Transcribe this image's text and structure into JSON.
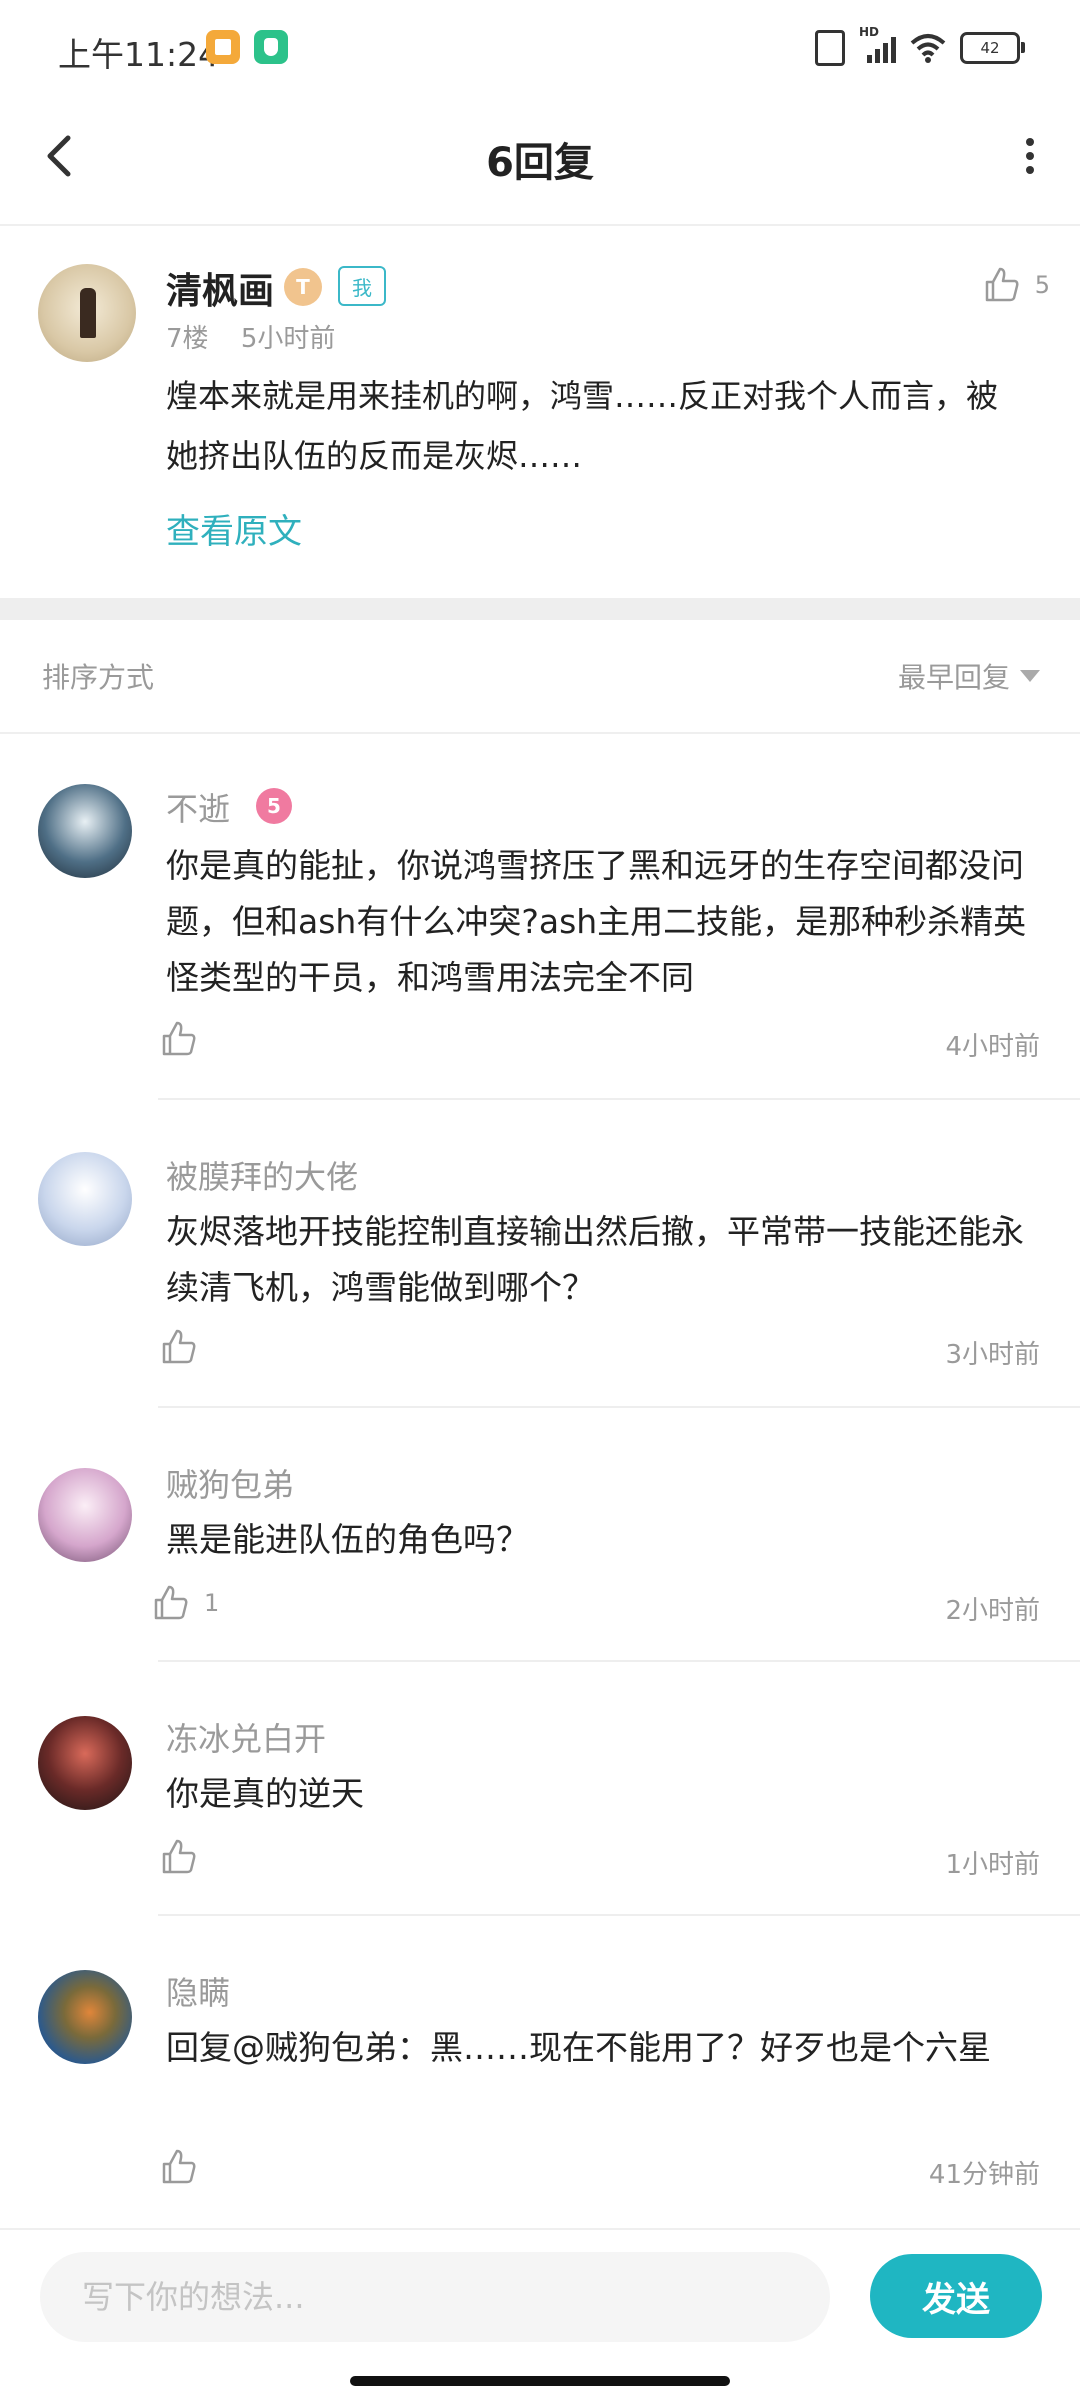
{
  "status_bar": {
    "time": "上午11:24",
    "battery": "42",
    "network": "HD"
  },
  "header": {
    "title": "6回复"
  },
  "post": {
    "author": "清枫画",
    "level_badge": "T",
    "me_badge": "我",
    "floor": "7楼",
    "time": "5小时前",
    "likes": "5",
    "content": "煌本来就是用来挂机的啊，鸿雪……反正对我个人而言，被她挤出队伍的反而是灰烬……",
    "view_original": "查看原文"
  },
  "sort": {
    "label": "排序方式",
    "selected": "最早回复"
  },
  "comments": [
    {
      "author": "不逝",
      "level": "5",
      "content": "你是真的能扯，你说鸿雪挤压了黑和远牙的生存空间都没问题，但和ash有什么冲突?ash主用二技能，是那种秒杀精英怪类型的干员，和鸿雪用法完全不同",
      "likes": "",
      "time": "4小时前"
    },
    {
      "author": "被膜拜的大佬",
      "content": "灰烬落地开技能控制直接输出然后撤，平常带一技能还能永续清飞机，鸿雪能做到哪个？",
      "likes": "",
      "time": "3小时前"
    },
    {
      "author": "贼狗包弟",
      "content": "黑是能进队伍的角色吗？",
      "likes": "1",
      "time": "2小时前"
    },
    {
      "author": "冻冰兑白开",
      "content": "你是真的逆天",
      "likes": "",
      "time": "1小时前"
    },
    {
      "author": "隐瞒",
      "content": "回复@贼狗包弟：黑……现在不能用了？好歹也是个六星",
      "likes": "",
      "time": "41分钟前"
    }
  ],
  "reply_bar": {
    "placeholder": "写下你的想法...",
    "send_label": "发送"
  },
  "colors": {
    "accent": "#1fb6c2",
    "link": "#2fb0bd",
    "muted": "#9a9a9a"
  },
  "icons": {
    "back": "chevron-left-icon",
    "more": "more-vertical-icon",
    "like": "thumbs-up-icon",
    "sort_caret": "caret-down-icon"
  }
}
